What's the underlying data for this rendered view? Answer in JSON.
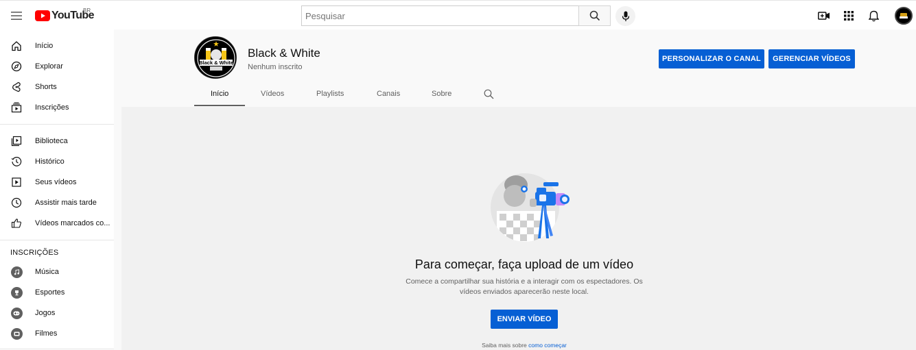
{
  "header": {
    "logo_text": "YouTube",
    "region": "BR",
    "search_placeholder": "Pesquisar"
  },
  "sidebar": {
    "main": [
      {
        "label": "Início",
        "icon": "home-icon"
      },
      {
        "label": "Explorar",
        "icon": "compass-icon"
      },
      {
        "label": "Shorts",
        "icon": "shorts-icon"
      },
      {
        "label": "Inscrições",
        "icon": "subscriptions-icon"
      }
    ],
    "library": [
      {
        "label": "Biblioteca",
        "icon": "library-icon"
      },
      {
        "label": "Histórico",
        "icon": "history-icon"
      },
      {
        "label": "Seus vídeos",
        "icon": "your-videos-icon"
      },
      {
        "label": "Assistir mais tarde",
        "icon": "watch-later-icon"
      },
      {
        "label": "Vídeos marcados co...",
        "icon": "thumbs-up-icon"
      }
    ],
    "subscriptions_heading": "INSCRIÇÕES",
    "subscriptions": [
      {
        "label": "Música",
        "icon": "music-icon"
      },
      {
        "label": "Esportes",
        "icon": "trophy-icon"
      },
      {
        "label": "Jogos",
        "icon": "gamepad-icon"
      },
      {
        "label": "Filmes",
        "icon": "film-icon"
      }
    ]
  },
  "channel": {
    "name": "Black & White",
    "subscribers": "Nenhum inscrito",
    "customize_label": "PERSONALIZAR O CANAL",
    "manage_label": "GERENCIAR VÍDEOS",
    "tabs": [
      "Início",
      "Vídeos",
      "Playlists",
      "Canais",
      "Sobre"
    ],
    "active_tab": "Início",
    "avatar_text": "Black & White"
  },
  "empty_state": {
    "title": "Para começar, faça upload de um vídeo",
    "description": "Comece a compartilhar sua história e a interagir com os espectadores. Os vídeos enviados aparecerão neste local.",
    "upload_label": "ENVIAR VÍDEO",
    "learn_prefix": "Saiba mais sobre",
    "learn_link": "como começar"
  },
  "colors": {
    "accent": "#065fd4",
    "logo_red": "#ff0000"
  }
}
